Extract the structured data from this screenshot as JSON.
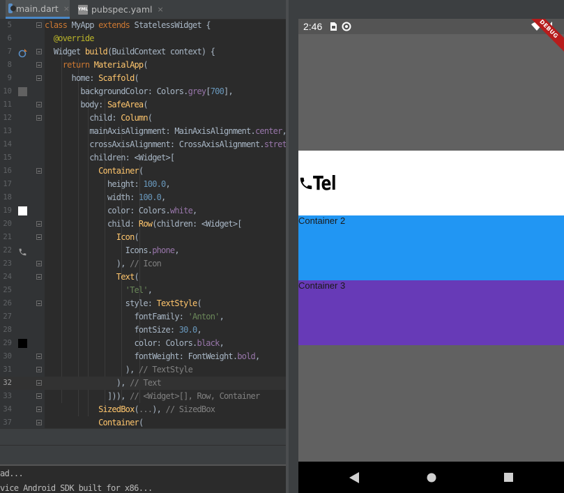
{
  "ide": {
    "tabs": [
      {
        "label": "main.dart",
        "close": "×"
      },
      {
        "label": "pubspec.yaml",
        "close": "×"
      }
    ],
    "current_line": "32",
    "lines": [
      {
        "num": "5",
        "tokens": [
          [
            "kw",
            "class "
          ],
          [
            "",
            "MyApp "
          ],
          [
            "kw",
            "extends "
          ],
          [
            "",
            "StatelessWidget {"
          ]
        ]
      },
      {
        "num": "6",
        "tokens": [
          [
            "",
            "  "
          ],
          [
            "an",
            "@override"
          ]
        ]
      },
      {
        "num": "7",
        "tokens": [
          [
            "",
            "  Widget "
          ],
          [
            "cl",
            "build"
          ],
          [
            "",
            "(BuildContext context) {"
          ]
        ]
      },
      {
        "num": "8",
        "tokens": [
          [
            "",
            "    "
          ],
          [
            "kw",
            "return "
          ],
          [
            "cl",
            "MaterialApp"
          ],
          [
            "",
            "("
          ]
        ]
      },
      {
        "num": "9",
        "tokens": [
          [
            "",
            "      home: "
          ],
          [
            "cl",
            "Scaffold"
          ],
          [
            "",
            "("
          ]
        ]
      },
      {
        "num": "10",
        "tokens": [
          [
            "",
            "        backgroundColor: Colors."
          ],
          [
            "pr",
            "grey"
          ],
          [
            "",
            "["
          ],
          [
            "nu",
            "700"
          ],
          [
            "",
            "],"
          ]
        ]
      },
      {
        "num": "11",
        "tokens": [
          [
            "",
            "        body: "
          ],
          [
            "cl",
            "SafeArea"
          ],
          [
            "",
            "("
          ]
        ]
      },
      {
        "num": "12",
        "tokens": [
          [
            "",
            "          child: "
          ],
          [
            "cl",
            "Column"
          ],
          [
            "",
            "("
          ]
        ]
      },
      {
        "num": "13",
        "tokens": [
          [
            "",
            "          mainAxisAlignment: MainAxisAlignment."
          ],
          [
            "pr",
            "center"
          ],
          [
            "",
            ","
          ]
        ]
      },
      {
        "num": "14",
        "tokens": [
          [
            "",
            "          crossAxisAlignment: CrossAxisAlignment."
          ],
          [
            "pr",
            "stretch"
          ],
          [
            "",
            ","
          ]
        ]
      },
      {
        "num": "15",
        "tokens": [
          [
            "",
            "          children: <Widget>["
          ]
        ]
      },
      {
        "num": "16",
        "tokens": [
          [
            "",
            "            "
          ],
          [
            "cl",
            "Container"
          ],
          [
            "",
            "("
          ]
        ]
      },
      {
        "num": "17",
        "tokens": [
          [
            "",
            "              height: "
          ],
          [
            "nu",
            "100.0"
          ],
          [
            "",
            ","
          ]
        ]
      },
      {
        "num": "18",
        "tokens": [
          [
            "",
            "              width: "
          ],
          [
            "nu",
            "100.0"
          ],
          [
            "",
            ","
          ]
        ]
      },
      {
        "num": "19",
        "tokens": [
          [
            "",
            "              color: Colors."
          ],
          [
            "pr",
            "white"
          ],
          [
            "",
            ","
          ]
        ]
      },
      {
        "num": "20",
        "tokens": [
          [
            "",
            "              child: "
          ],
          [
            "cl",
            "Row"
          ],
          [
            "",
            "(children: <Widget>["
          ]
        ]
      },
      {
        "num": "21",
        "tokens": [
          [
            "",
            "                "
          ],
          [
            "cl",
            "Icon"
          ],
          [
            "",
            "("
          ]
        ]
      },
      {
        "num": "22",
        "tokens": [
          [
            "",
            "                  Icons."
          ],
          [
            "pr",
            "phone"
          ],
          [
            "",
            ","
          ]
        ]
      },
      {
        "num": "23",
        "tokens": [
          [
            "",
            "                ), "
          ],
          [
            "cm",
            "// Icon"
          ]
        ]
      },
      {
        "num": "24",
        "tokens": [
          [
            "",
            "                "
          ],
          [
            "cl",
            "Text"
          ],
          [
            "",
            "("
          ]
        ]
      },
      {
        "num": "25",
        "tokens": [
          [
            "",
            "                  "
          ],
          [
            "st",
            "'Tel'"
          ],
          [
            "",
            ","
          ]
        ]
      },
      {
        "num": "26",
        "tokens": [
          [
            "",
            "                  style: "
          ],
          [
            "cl",
            "TextStyle"
          ],
          [
            "",
            "("
          ]
        ]
      },
      {
        "num": "27",
        "tokens": [
          [
            "",
            "                    fontFamily: "
          ],
          [
            "st",
            "'Anton'"
          ],
          [
            "",
            ","
          ]
        ]
      },
      {
        "num": "28",
        "tokens": [
          [
            "",
            "                    fontSize: "
          ],
          [
            "nu",
            "30.0"
          ],
          [
            "",
            ","
          ]
        ]
      },
      {
        "num": "29",
        "tokens": [
          [
            "",
            "                    color: Colors."
          ],
          [
            "pr",
            "black"
          ],
          [
            "",
            ","
          ]
        ]
      },
      {
        "num": "30",
        "tokens": [
          [
            "",
            "                    fontWeight: FontWeight."
          ],
          [
            "pr",
            "bold"
          ],
          [
            "",
            ","
          ]
        ]
      },
      {
        "num": "31",
        "tokens": [
          [
            "",
            "                  ), "
          ],
          [
            "cm",
            "// TextStyle"
          ]
        ]
      },
      {
        "num": "32",
        "tokens": [
          [
            "",
            "                ), "
          ],
          [
            "cm",
            "// Text"
          ]
        ]
      },
      {
        "num": "33",
        "tokens": [
          [
            "",
            "              ])), "
          ],
          [
            "cm",
            "// <Widget>[], Row, Container"
          ]
        ]
      },
      {
        "num": "34",
        "tokens": [
          [
            "",
            "            "
          ],
          [
            "cl",
            "SizedBox"
          ],
          [
            "",
            "("
          ],
          [
            "cm",
            "..."
          ],
          [
            "",
            "), "
          ],
          [
            "cm",
            "// SizedBox"
          ]
        ]
      },
      {
        "num": "37",
        "tokens": [
          [
            "",
            "            "
          ],
          [
            "cl",
            "Container"
          ],
          [
            "",
            "("
          ]
        ]
      }
    ],
    "console": [
      "ad...",
      "vice Android SDK built for x86..."
    ]
  },
  "emulator": {
    "time": "2:46",
    "debug_banner": "DEBUG",
    "tel_label": "Tel",
    "container2_label": "Container 2",
    "container3_label": "Container 3",
    "colors": {
      "background": "#616161",
      "container1": "#ffffff",
      "container2": "#2196f3",
      "container3": "#673ab7"
    }
  }
}
